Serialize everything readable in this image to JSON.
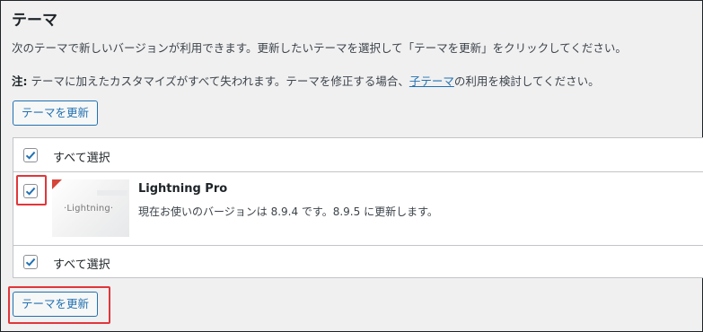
{
  "page": {
    "title": "テーマ",
    "description": "次のテーマで新しいバージョンが利用できます。更新したいテーマを選択して「テーマを更新」をクリックしてください。",
    "note_label": "注:",
    "note_before": " テーマに加えたカスタマイズがすべて失われます。テーマを修正する場合、",
    "note_link": "子テーマ",
    "note_after": "の利用を検討してください。",
    "update_button_top": "テーマを更新",
    "update_button_bottom": "テーマを更新"
  },
  "table": {
    "select_all_top": "すべて選択",
    "select_all_bottom": "すべて選択",
    "items": [
      {
        "name": "Lightning Pro",
        "thumbnail_text": "·Lightning·",
        "status": "現在お使いのバージョンは 8.9.4 です。8.9.5 に更新します。",
        "checked": true
      }
    ]
  },
  "colors": {
    "accent": "#2271b1",
    "highlight": "#e0363a",
    "background": "#f0f0f1"
  },
  "icons": {
    "checkbox_checked": "checkmark-icon"
  }
}
